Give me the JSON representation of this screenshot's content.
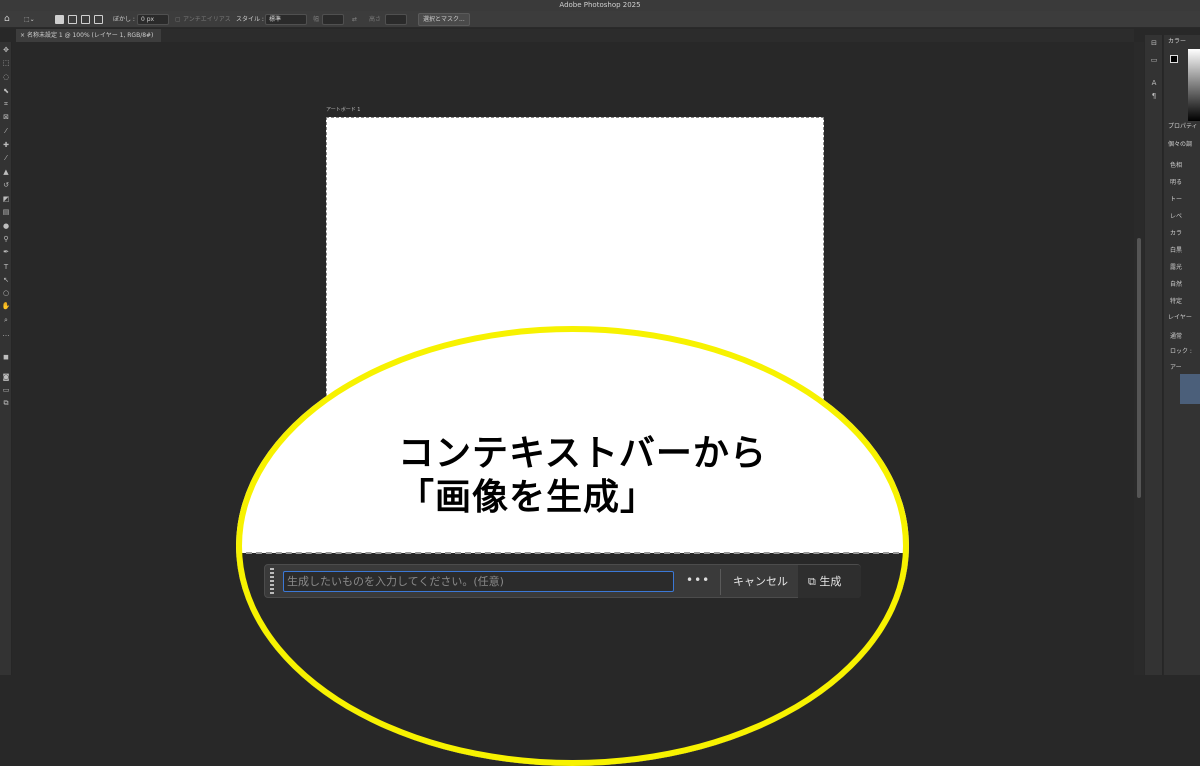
{
  "app": {
    "title": "Adobe Photoshop 2025"
  },
  "options_bar": {
    "feather_label": "ぼかし :",
    "feather_value": "0 px",
    "antialias_label": "アンチエイリアス",
    "style_label": "スタイル :",
    "style_value": "標準",
    "width_label": "幅",
    "height_label": "高さ",
    "select_mask_button": "選択とマスク..."
  },
  "document_tab": {
    "close_glyph": "×",
    "label": "名称未設定 1 @ 100% (レイヤー 1, RGB/8#)"
  },
  "artboard": {
    "label": "アートボード 1"
  },
  "annotation": {
    "line1": "コンテキストバーから",
    "line2": "「画像を生成」",
    "ring_color": "#f7f200"
  },
  "context_bar": {
    "prompt_placeholder": "生成したいものを入力してください。(任意)",
    "more_glyph": "•••",
    "cancel_label": "キャンセル",
    "generate_label": "生成"
  },
  "right_panel": {
    "color_tab": "カラー",
    "properties_tab": "プロパティ",
    "properties_section": "個々の調",
    "adjustments": [
      "色相",
      "明る",
      "トー",
      "レベ",
      "カラ",
      "白黒",
      "露光",
      "自然",
      "特定"
    ],
    "layers_tab": "レイヤー",
    "blend_mode": "通常",
    "lock_label": "ロック :",
    "layer_group": "アー"
  }
}
